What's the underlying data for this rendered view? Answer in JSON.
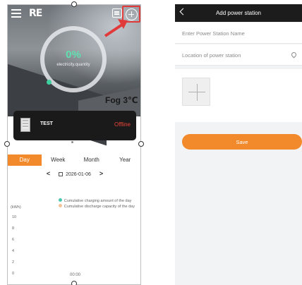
{
  "left": {
    "logo": "RE",
    "overview": {
      "percent": "0%",
      "label": "electricity.quantity"
    },
    "weather": "Fog 3℃",
    "device": {
      "name": "TEST",
      "status": "Offline"
    },
    "tabs": [
      {
        "label": "Day",
        "active": true
      },
      {
        "label": "Week",
        "active": false
      },
      {
        "label": "Month",
        "active": false
      },
      {
        "label": "Year",
        "active": false
      }
    ],
    "date": "2026-01-06",
    "chart": {
      "legend": [
        {
          "label": "Cumulative charging amount of the day",
          "color": "#4cc7b0"
        },
        {
          "label": "Cumulative discharge capacity of the day",
          "color": "#f4c39a"
        }
      ],
      "unit": "(kWh)",
      "y_ticks": [
        "10",
        "8",
        "6",
        "4",
        "2",
        "0"
      ],
      "x_ticks": [
        "00:00"
      ]
    }
  },
  "right": {
    "title": "Add power station",
    "name_placeholder": "Enter Power Station Name",
    "location_placeholder": "Location of power station",
    "save_label": "Save"
  },
  "colors": {
    "accent": "#f28a2c",
    "highlight": "#e03a3a",
    "offline": "#e8443a"
  }
}
